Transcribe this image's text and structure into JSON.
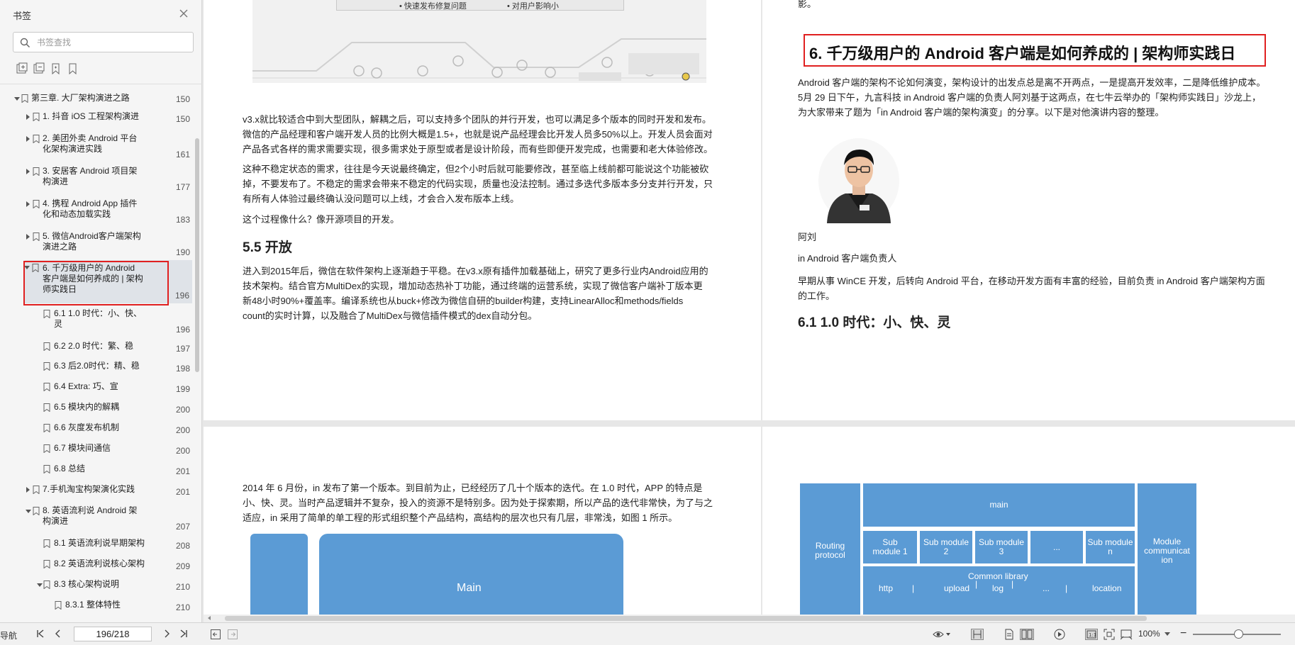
{
  "sidebar": {
    "title": "书签",
    "search_placeholder": "书签查找",
    "tree": [
      {
        "label": "第三章. 大厂架构演进之路",
        "page": "150"
      },
      {
        "label": "1. 抖音 iOS 工程架构演进",
        "page": "150"
      },
      {
        "label_1": "2. 美团外卖 Android 平台",
        "label_2": "化架构演进实践",
        "page": "161"
      },
      {
        "label_1": "3. 安居客 Android 项目架",
        "label_2": "构演进",
        "page": "177"
      },
      {
        "label_1": "4. 携程 Android App 插件",
        "label_2": "化和动态加载实践",
        "page": "183"
      },
      {
        "label_1": "5. 微信Android客户端架构",
        "label_2": "演进之路",
        "page": "190"
      },
      {
        "label_1": "6. 千万级用户的 Android",
        "label_2": "客户端是如何养成的 | 架构",
        "label_3": "师实践日",
        "page": "196"
      },
      {
        "label_1": "6.1   1.0 时代：小、快、",
        "label_2": "灵",
        "page": "196"
      },
      {
        "label": "6.2    2.0 时代：繁、稳",
        "page": "197"
      },
      {
        "label": "6.3    后2.0时代：精、稳",
        "page": "198"
      },
      {
        "label": "6.4  Extra: 巧、宣",
        "page": "199"
      },
      {
        "label": "6.5   模块内的解耦",
        "page": "200"
      },
      {
        "label": "6.6  灰度发布机制",
        "page": "200"
      },
      {
        "label": "6.7   模块间通信",
        "page": "200"
      },
      {
        "label": "6.8   总结",
        "page": "201"
      },
      {
        "label": "7.手机淘宝构架演化实践",
        "page": "201"
      },
      {
        "label_1": "8. 英语流利说 Android 架",
        "label_2": "构演进",
        "page": "207"
      },
      {
        "label": "8.1  英语流利说早期架构",
        "page": "208"
      },
      {
        "label": "8.2  英语流利说核心架构",
        "page": "209"
      },
      {
        "label": "8.3  核心架构说明",
        "page": "210"
      },
      {
        "label": "8.3.1  整体特性",
        "page": "210"
      }
    ]
  },
  "pages": {
    "p1": {
      "illus_items": [
        "快速发布修复问题",
        "对用户影响小"
      ],
      "para1": [
        "v3.x就比较适合中到大型团队，解耦之后，可以支持多个团队的并行开发，也可以满足多个版本的同时开发和发布。",
        "微信的产品经理和客户端开发人员的比例大概是1.5+，也就是说产品经理会比开发人员多50%以上。开发人员会面对",
        "产品各式各样的需求需要实现，很多需求处于原型或者是设计阶段，而有些即便开发完成，也需要和老大体验修改。"
      ],
      "para2": [
        "这种不稳定状态的需求，往往是今天说最终确定，但2个小时后就可能要修改，甚至临上线前都可能说这个功能被砍",
        "掉，不要发布了。不稳定的需求会带来不稳定的代码实现，质量也没法控制。通过多迭代多版本多分支并行开发，只",
        "有所有人体验过最终确认没问题可以上线，才会合入发布版本上线。"
      ],
      "para3": "这个过程像什么？像开源项目的开发。",
      "h_open": "5.5 开放",
      "para4": [
        "进入到2015年后，微信在软件架构上逐渐趋于平稳。在v3.x原有插件加载基础上，研究了更多行业内Android应用的",
        "技术架构。结合官方MultiDex的实现，增加动态热补丁功能，通过终端的运营系统，实现了微信客户端补丁版本更",
        "新48小时90%+覆盖率。编译系统也从buck+修改为微信自研的builder构建，支持LinearAlloc和methods/fields",
        "count的实时计算，以及融合了MultiDex与微信插件模式的dex自动分包。"
      ]
    },
    "p2": {
      "top_char": "影。",
      "heading": "6. 千万级用户的 Android 客户端是如何养成的 | 架构师实践日",
      "intro": [
        "Android 客户端的架构不论如何演变，架构设计的出发点总是离不开两点，一是提高开发效率，二是降低维护成本。",
        "5月 29 日下午，九言科技 in Android 客户端的负责人阿刘基于这两点，在七牛云举办的「架构师实践日」沙龙上，",
        "为大家带来了题为「in Android 客户端的架构演变」的分享。以下是对他演讲内容的整理。"
      ],
      "person_name": "阿刘",
      "person_role": "in Android 客户端负责人",
      "bio": [
        "早期从事 WinCE 开发，后转向 Android 平台，在移动开发方面有丰富的经验，目前负责 in Android 客户端架构方面",
        "的工作。"
      ],
      "h61": "6.1 1.0 时代：小、快、灵"
    },
    "p3": {
      "para": [
        "2014 年 6 月份，in 发布了第一个版本。到目前为止，已经经历了几十个版本的迭代。在 1.0 时代，APP 的特点是",
        "小、快、灵。当时产品逻辑并不复杂，投入的资源不是特别多。因为处于探索期，所以产品的迭代非常快，为了与之",
        "适应，in 采用了简单的单工程的形式组织整个产品结构，高结构的层次也只有几层，非常浅，如图 1 所示。"
      ],
      "main_label": "Main"
    },
    "p4": {
      "routing": [
        "Routing",
        "protocol"
      ],
      "main": "main",
      "sub1": [
        "Sub",
        "module 1"
      ],
      "sub2": [
        "Sub module",
        "2"
      ],
      "sub3": [
        "Sub module",
        "3"
      ],
      "dots": "...",
      "subn": [
        "Sub module",
        "n"
      ],
      "module_comm": [
        "Module",
        "communicat",
        "ion"
      ],
      "common_lib": "Common library",
      "libs": [
        "http",
        "upload",
        "log",
        "...",
        "location"
      ],
      "sep": "|"
    }
  },
  "statusbar": {
    "nav_label": "导航",
    "page_display": "196/218",
    "zoom": "100%"
  },
  "colors": {
    "accent_red": "#e02020",
    "diagram_blue": "#5b9bd5"
  }
}
